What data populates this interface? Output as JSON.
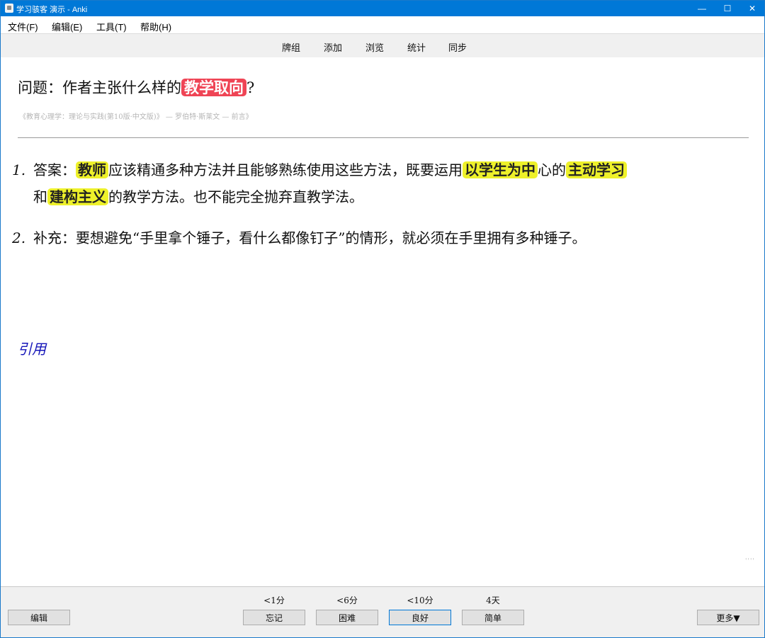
{
  "window": {
    "title": "学习骇客 演示 - Anki",
    "minimize": "—",
    "maximize": "☐",
    "close": "✕"
  },
  "menubar": {
    "file": "文件(F)",
    "edit": "编辑(E)",
    "tools": "工具(T)",
    "help": "帮助(H)"
  },
  "toolbar": {
    "decks": "牌组",
    "add": "添加",
    "browse": "浏览",
    "stats": "统计",
    "sync": "同步"
  },
  "card": {
    "question": {
      "prefix": "问题：作者主张什么样的",
      "highlight": "教学取向",
      "suffix": "?"
    },
    "source": "《教育心理学：理论与实践(第10版·中文版)》 — 罗伯特·斯莱文 — 前言》",
    "answers": [
      {
        "number": "1.",
        "label": "答案：",
        "hl1": "教师",
        "text1": "应该精通多种方法并且能够熟练使用这些方法，既要运用",
        "hl2": "以学生为中",
        "text2": "心的",
        "hl3": "主动学习",
        "text3": "和",
        "hl4": "建构主义",
        "text4": "的教学方法。也不能完全抛弃直教学法。"
      },
      {
        "number": "2.",
        "label": "补充：",
        "text": "要想避免“手里拿个锤子，看什么都像钉子”的情形，就必须在手里拥有多种锤子。"
      }
    ],
    "cite": "引用",
    "highlight_colors": {
      "red": "#ef4455",
      "yellow": "#eef12a"
    }
  },
  "bottombar": {
    "edit_label": "编辑",
    "more_label": "更多▼",
    "ease": [
      {
        "time": "<1分",
        "label": "忘记"
      },
      {
        "time": "<6分",
        "label": "困难"
      },
      {
        "time": "<10分",
        "label": "良好"
      },
      {
        "time": "4天",
        "label": "简单"
      }
    ]
  }
}
